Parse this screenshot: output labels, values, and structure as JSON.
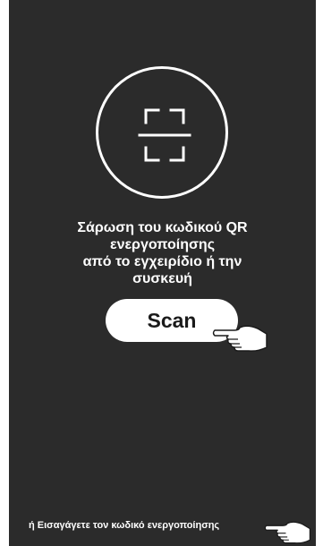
{
  "instruction": {
    "line1": "Σάρωση του κωδικού QR",
    "line2": "ενεργοποίησης",
    "line3": "από το εγχειρίδιο ή την",
    "line4": "συσκευή"
  },
  "scan_button": {
    "label": "Scan"
  },
  "enter_code_link": {
    "label": "ή Εισαγάγετε τον κωδικό ενεργοποίησης"
  },
  "icons": {
    "scan_frame": "qr-scan-frame-icon",
    "pointer_hand": "pointing-hand-icon"
  },
  "colors": {
    "background": "#2b2b2b",
    "foreground": "#ffffff",
    "button_text": "#1a1a1a"
  }
}
